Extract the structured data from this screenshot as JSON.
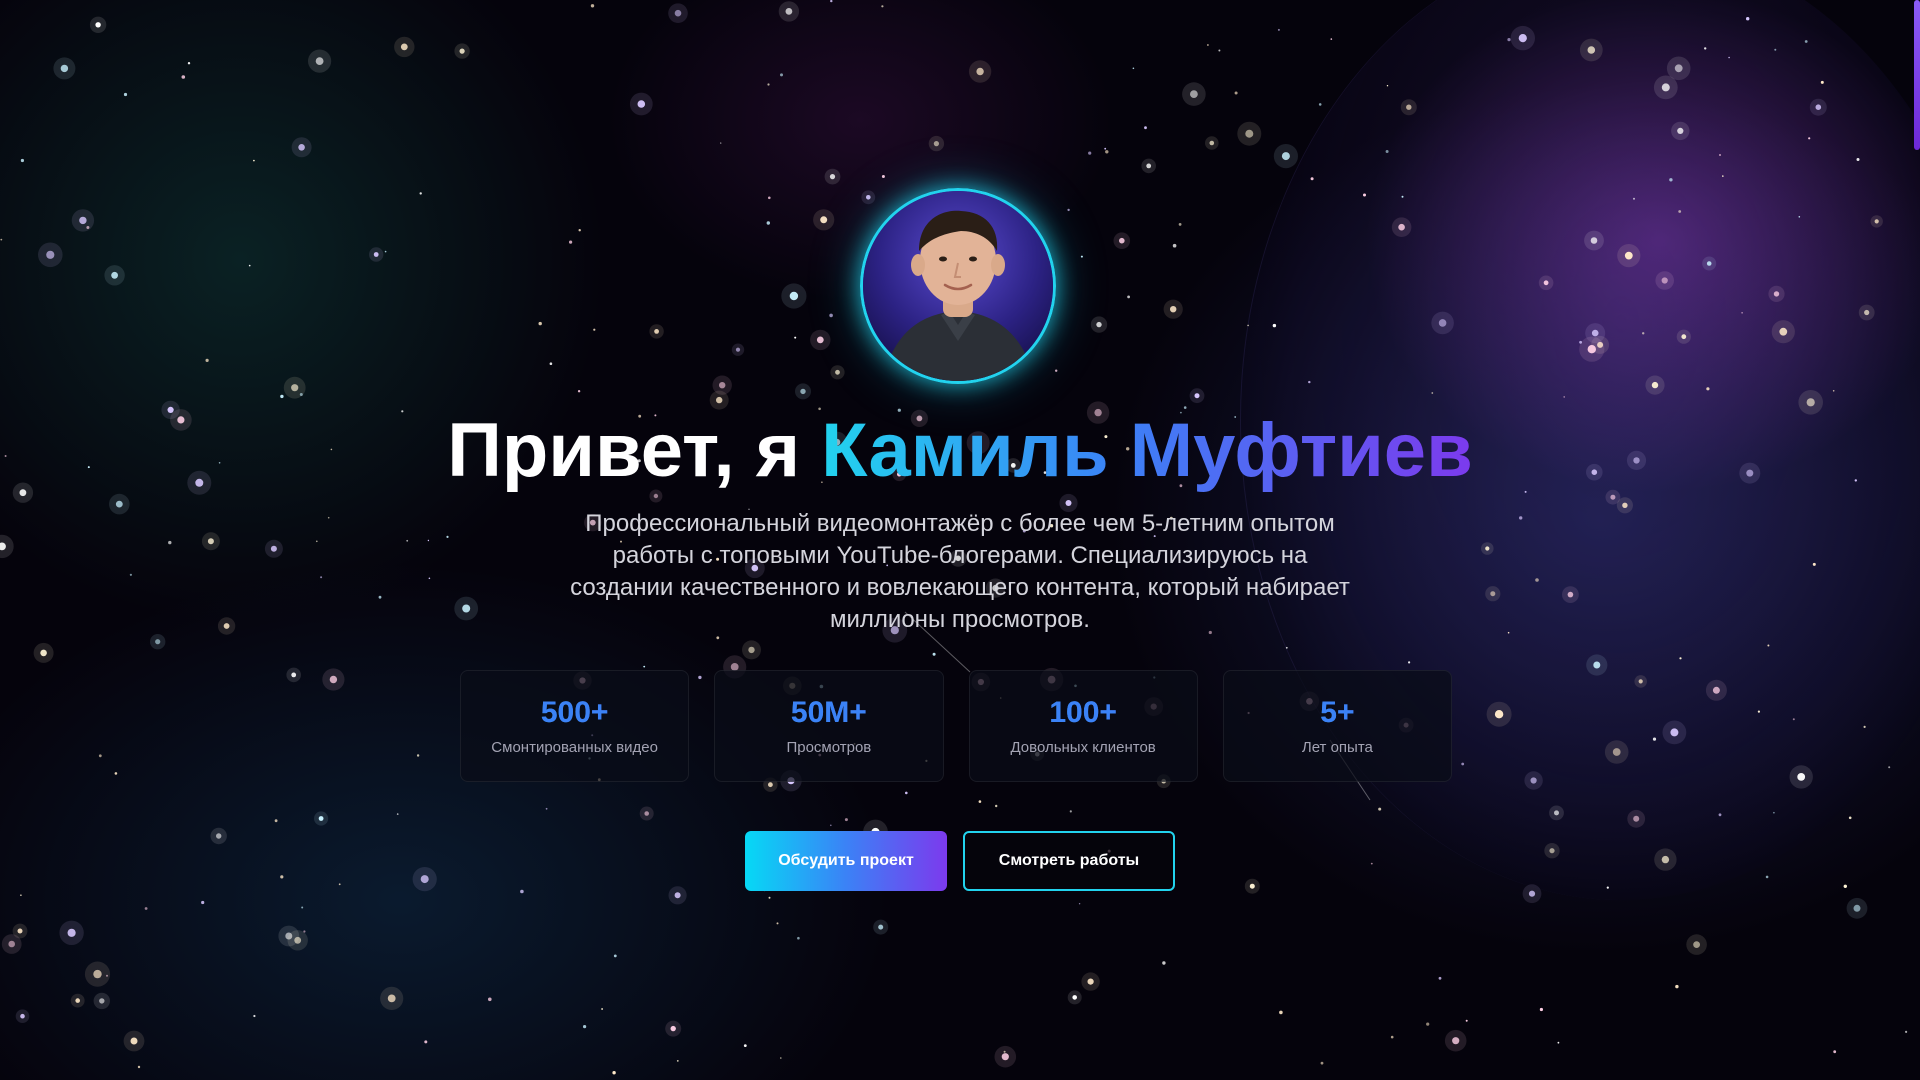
{
  "hero": {
    "greeting": "Привет, я ",
    "name": "Камиль Муфтиев",
    "description": "Профессиональный видеомонтажёр с более чем 5-летним опытом работы с топовыми YouTube-блогерами. Специализируюсь на создании качественного и вовлекающего контента, который набирает миллионы просмотров."
  },
  "stats": [
    {
      "value": "500+",
      "label": "Смонтированных видео"
    },
    {
      "value": "50M+",
      "label": "Просмотров"
    },
    {
      "value": "100+",
      "label": "Довольных клиентов"
    },
    {
      "value": "5+",
      "label": "Лет опыта"
    }
  ],
  "buttons": {
    "primary_label": "Обсудить проект",
    "secondary_label": "Смотреть работы"
  },
  "colors": {
    "accent_cyan": "#22d3ee",
    "accent_blue": "#3b82f6",
    "accent_violet": "#7c3aed",
    "background": "#05030c"
  }
}
